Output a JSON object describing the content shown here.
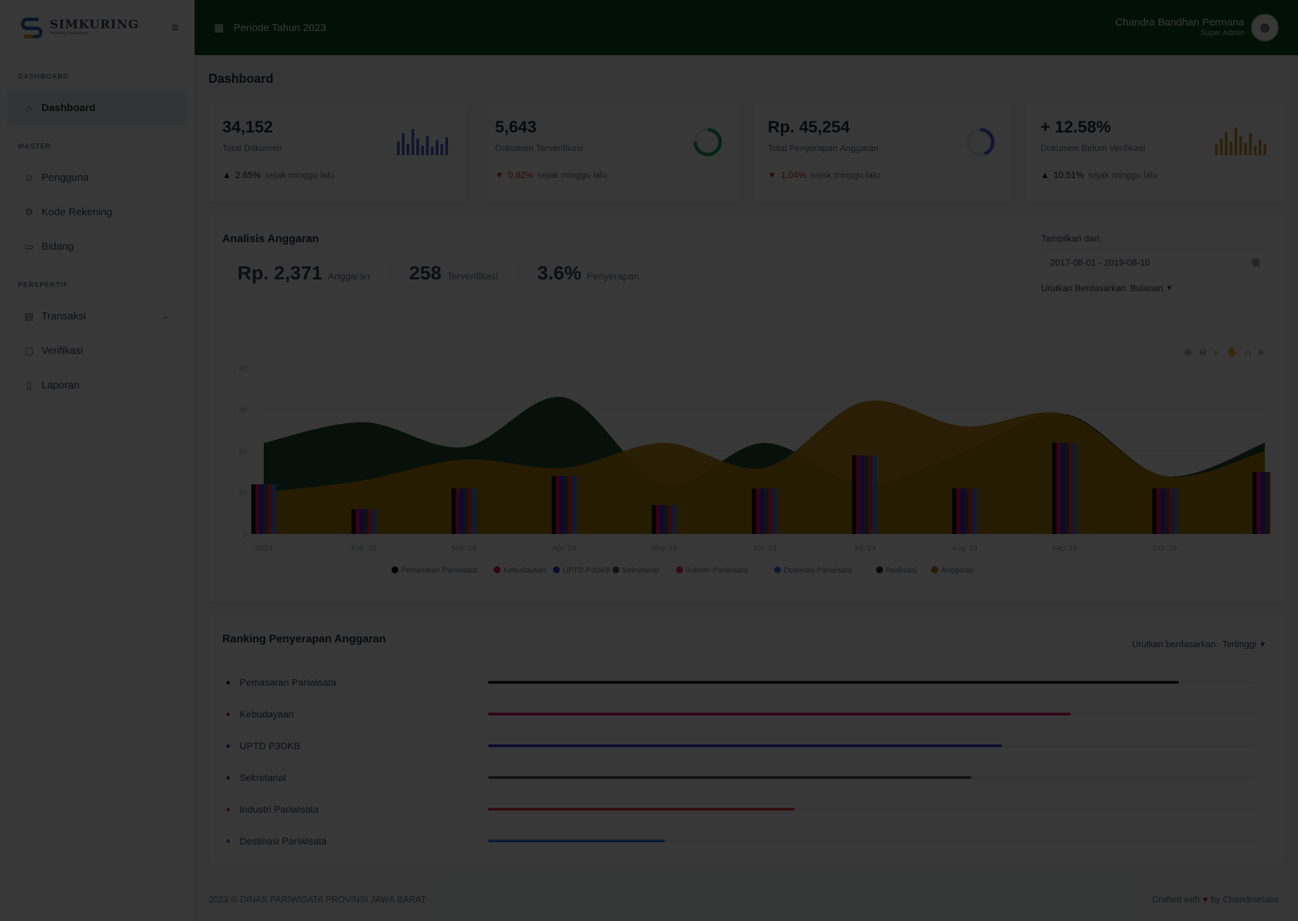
{
  "brand": {
    "name": "SIMKURING",
    "tagline": "PROVINSI JAWA BARAT"
  },
  "sidebar": {
    "sections": [
      {
        "head": "DASHBOARD",
        "items": [
          {
            "label": "Dashboard",
            "icon": "home-icon",
            "active": true
          }
        ]
      },
      {
        "head": "MASTER",
        "items": [
          {
            "label": "Pengguna",
            "icon": "user-icon"
          },
          {
            "label": "Kode Rekening",
            "icon": "gear-icon"
          },
          {
            "label": "Bidang",
            "icon": "folder-icon"
          }
        ]
      },
      {
        "head": "PERSPEKTIF",
        "items": [
          {
            "label": "Transaksi",
            "icon": "card-icon",
            "has_sub": true
          },
          {
            "label": "Verifikasi",
            "icon": "check-icon"
          },
          {
            "label": "Laporan",
            "icon": "file-icon"
          }
        ]
      }
    ]
  },
  "topbar": {
    "period": "Periode Tahun 2023",
    "user_name": "Chandra Bandhan Permana",
    "user_role": "Super Admin"
  },
  "page": {
    "title": "Dashboard"
  },
  "stats": [
    {
      "value": "34,152",
      "label": "Total Dokumen",
      "change": "2.65%",
      "direction": "up",
      "suffix": "sejak minggu lalu",
      "color": "#5c5ce0",
      "spark": "bars"
    },
    {
      "value": "5,643",
      "label": "Dokumen Terverifikasi",
      "change": "0.82%",
      "direction": "down",
      "suffix": "sejak minggu lalu",
      "color": "#22a06b",
      "spark": "ring"
    },
    {
      "value": "Rp. 45,254",
      "label": "Total Penyerapan Anggaran",
      "change": "1.04%",
      "direction": "down",
      "suffix": "sejak minggu lalu",
      "color": "#5c5ce0",
      "spark": "ring"
    },
    {
      "value": "+ 12.58%",
      "label": "Dokumen Belum Verifikasi",
      "change": "10.51%",
      "direction": "up",
      "suffix": "sejak minggu lalu",
      "color": "#c99a2e",
      "spark": "bars"
    }
  ],
  "analysis": {
    "title": "Analisis Anggaran",
    "kpis": [
      {
        "value": "Rp. 2,371",
        "label": "Anggaran"
      },
      {
        "value": "258",
        "label": "Terverifikasi"
      },
      {
        "value": "3.6%",
        "label": "Penyerapan"
      }
    ],
    "range_label": "Tampilkan dari:",
    "range_value": "2017-08-01 - 2019-08-10",
    "sort_label": "Urutkan Berdasarkan",
    "sort_value": "Bulanan"
  },
  "chart_data": {
    "type": "bar",
    "categories": [
      "2019",
      "Feb '19",
      "Mar '19",
      "Apr '19",
      "May '19",
      "Jun '19",
      "Jul '19",
      "Aug '19",
      "Sep '19",
      "Oct '19",
      ""
    ],
    "ylim": [
      0,
      40
    ],
    "yticks": [
      "0",
      "10",
      "20",
      "30",
      "40"
    ],
    "ylabel": "",
    "areas": [
      {
        "name": "Realisasi",
        "color": "#0d3d1d",
        "values": [
          22,
          27,
          21,
          33,
          12,
          22,
          12,
          20,
          29,
          14,
          22
        ]
      },
      {
        "name": "Anggaran",
        "color": "#b8860b",
        "values": [
          10,
          13,
          18,
          16,
          22,
          16,
          32,
          26,
          29,
          14,
          20
        ]
      }
    ],
    "series": [
      {
        "name": "Pemasaran Pariwisata",
        "color": "#111111",
        "values": [
          12,
          6,
          11,
          14,
          7,
          11,
          19,
          11,
          22,
          11,
          15
        ]
      },
      {
        "name": "Kebudayaan",
        "color": "#e0115f",
        "values": [
          12,
          6,
          11,
          14,
          7,
          11,
          19,
          11,
          22,
          11,
          15
        ]
      },
      {
        "name": "UPTD P3DKB",
        "color": "#3b2fd6",
        "values": [
          12,
          6,
          11,
          14,
          7,
          11,
          19,
          11,
          22,
          11,
          15
        ]
      },
      {
        "name": "Sekretariat",
        "color": "#555555",
        "values": [
          12,
          6,
          11,
          14,
          7,
          11,
          19,
          11,
          22,
          11,
          15
        ]
      },
      {
        "name": "Industri Pariwisata",
        "color": "#e53946",
        "values": [
          12,
          6,
          11,
          14,
          7,
          11,
          19,
          11,
          22,
          11,
          15
        ]
      },
      {
        "name": "Destinasi Pariwisata",
        "color": "#3b82f6",
        "values": [
          12,
          6,
          11,
          14,
          7,
          11,
          19,
          11,
          22,
          11,
          15
        ]
      }
    ],
    "legend_position": "bottom"
  },
  "ranking": {
    "title": "Ranking Penyerapan Anggaran",
    "sort_label": "Urutkan berdasarkan:",
    "sort_value": "Tertinggi",
    "items": [
      {
        "name": "Pemasaran Pariwisata",
        "color": "#111111",
        "value": 0.9
      },
      {
        "name": "Kebudayaan",
        "color": "#e0115f",
        "value": 0.76
      },
      {
        "name": "UPTD P3DKB",
        "color": "#3b2fd6",
        "value": 0.67
      },
      {
        "name": "Sekretariat",
        "color": "#555555",
        "value": 0.63
      },
      {
        "name": "Industri Pariwisata",
        "color": "#e53946",
        "value": 0.4
      },
      {
        "name": "Destinasi Pariwisata",
        "color": "#3b82f6",
        "value": 0.23
      }
    ]
  },
  "footer": {
    "left": "2023 © DINAS PARIWISATA PROVINSI JAWA BARAT",
    "right_prefix": "Crafted with",
    "right_suffix": "by Chandraelabs"
  },
  "colors": {
    "topbar": "#064e1f",
    "active_menu_bg": "#e8edf0",
    "overlay": "rgba(0,0,0,0.78)"
  }
}
